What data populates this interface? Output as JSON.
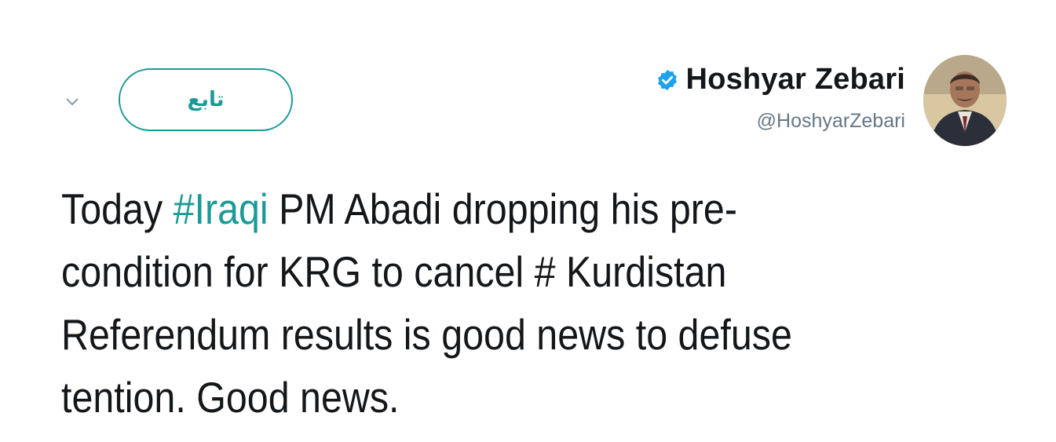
{
  "follow_button": {
    "label": "تابع"
  },
  "author": {
    "display_name": "Hoshyar Zebari",
    "handle": "@HoshyarZebari",
    "verified": true
  },
  "tweet": {
    "lines": [
      [
        {
          "text": "Today ",
          "type": "text"
        },
        {
          "text": "#Iraqi",
          "type": "hashtag"
        },
        {
          "text": " PM Abadi dropping his pre-",
          "type": "text"
        }
      ],
      [
        {
          "text": "condition for KRG to cancel # Kurdistan",
          "type": "text"
        }
      ],
      [
        {
          "text": "Referendum results is good news to defuse",
          "type": "text"
        }
      ],
      [
        {
          "text": "tention. Good news.",
          "type": "text"
        }
      ]
    ]
  },
  "icons": {
    "chevron": "chevron-down-icon",
    "verified": "verified-badge-icon"
  },
  "colors": {
    "accent": "#1b9a96",
    "verified": "#1da1f2",
    "text": "#14171a",
    "secondary_text": "#657786"
  }
}
